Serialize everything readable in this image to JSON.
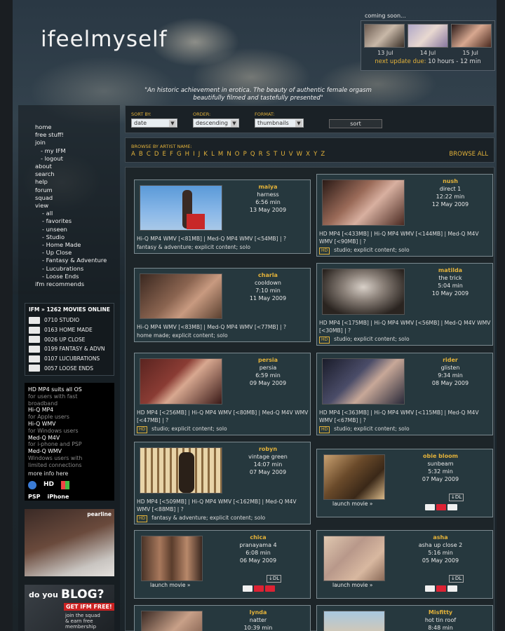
{
  "site": {
    "logo": "ifeelmyself",
    "tagline_line1": "\"An historic achievement in erotica. The beauty of authentic female orgasm",
    "tagline_line2": "beautifully filmed and tastefully presented\""
  },
  "coming_soon": {
    "title": "coming soon...",
    "dates": [
      "13 Jul",
      "14 Jul",
      "15 Jul"
    ],
    "next_update_label": "next update due:",
    "next_update_value": "10 hours - 12 min"
  },
  "menu": {
    "items": [
      "home",
      "free stuff!",
      "join"
    ],
    "join_sub": [
      "- my IFM",
      "- logout"
    ],
    "items2": [
      "about",
      "search",
      "help",
      "forum",
      "squad",
      "view"
    ],
    "view_sub": [
      "- all",
      "- favorites",
      "- unseen",
      "- Studio",
      "- Home Made",
      "- Up Close",
      "- Fantasy & Adventure",
      "- Lucubrations",
      "- Loose Ends"
    ],
    "last": "ifm recommends"
  },
  "ifm_online": {
    "title": "IFM » 1262 MOVIES ONLINE",
    "rows": [
      "0710 STUDIO",
      "0163 HOME MADE",
      "0026 UP CLOSE",
      "0199 FANTASY & ADVN",
      "0107 LUCUBRATIONS",
      "0057 LOOSE ENDS"
    ]
  },
  "formats": {
    "hd_title": "HD MP4 suits all OS",
    "hd_desc1": "for users with fast",
    "hd_desc2": "broadband",
    "hiq_mp4_title": "Hi-Q MP4",
    "hiq_mp4_desc": "for Apple users",
    "hiq_wmv_title": "Hi-Q WMV",
    "hiq_wmv_desc": "for Windows users",
    "medq_m4v_title": "Med-Q M4V",
    "medq_m4v_desc": "for i-phone and PSP",
    "medq_wmv_title": "Med-Q WMV",
    "medq_wmv_desc1": "Windows users with",
    "medq_wmv_desc2": "limited connections",
    "more": "more info here",
    "brand_hd": "HD",
    "brand_psp": "PSP",
    "brand_iphone": "iPhone"
  },
  "promo": {
    "pearline": "pearline",
    "blog_doyou": "do you",
    "blog_big": "BLOG?",
    "blog_ifm": "GET IFM FREE!",
    "blog_join1": "join the squad",
    "blog_join2": "& earn free",
    "blog_join3": "membership"
  },
  "filters": {
    "sort_by_label": "SORT BY:",
    "sort_by_value": "date",
    "order_label": "ORDER:",
    "order_value": "descending",
    "format_label": "FORMAT:",
    "format_value": "thumbnails",
    "sort_button": "sort",
    "browse_label": "BROWSE BY ARTIST NAME:",
    "letters": "A B C D E F G H I J K L M N O P Q R S T U V W X Y Z",
    "browse_all": "BROWSE ALL"
  },
  "cards": [
    {
      "name": "maiya",
      "title": "harness",
      "duration": "6:56 min",
      "date": "13 May 2009",
      "links": "Hi-Q MP4 WMV [<81MB] | Med-Q MP4 WMV [<54MB] | ?",
      "tags": "fantasy & adventure; explicit content; solo"
    },
    {
      "name": "nush",
      "title": "direct 1",
      "duration": "12:22 min",
      "date": "12 May 2009",
      "links": "HD MP4 [<433MB] | Hi-Q MP4 WMV [<144MB] | Med-Q M4V WMV [<90MB] | ?",
      "tags": "studio; explicit content; solo"
    },
    {
      "name": "charla",
      "title": "cooldown",
      "duration": "7:10 min",
      "date": "11 May 2009",
      "links": "Hi-Q MP4 WMV [<83MB] | Med-Q MP4 WMV [<77MB] | ?",
      "tags": "home made; explicit content; solo"
    },
    {
      "name": "matilda",
      "title": "the trick",
      "duration": "5:04 min",
      "date": "10 May 2009",
      "links": "HD MP4 [<175MB] | Hi-Q MP4 WMV [<56MB] | Med-Q M4V WMV [<30MB] | ?",
      "tags": "studio; explicit content; solo"
    },
    {
      "name": "persia",
      "title": "persia",
      "duration": "6:59 min",
      "date": "09 May 2009",
      "links": "HD MP4 [<256MB] | Hi-Q MP4 WMV [<80MB] | Med-Q M4V WMV [<47MB] | ?",
      "tags": "studio; explicit content; solo"
    },
    {
      "name": "rider",
      "title": "glisten",
      "duration": "9:34 min",
      "date": "08 May 2009",
      "links": "HD MP4 [<363MB] | Hi-Q MP4 WMV [<115MB] | Med-Q M4V WMV [<67MB] | ?",
      "tags": "studio; explicit content; solo"
    },
    {
      "name": "robyn",
      "title": "vintage green",
      "duration": "14:07 min",
      "date": "07 May 2009",
      "links": "HD MP4 [<509MB] | Hi-Q MP4 WMV [<162MB] | Med-Q M4V WMV [<88MB] | ?",
      "tags": "fantasy & adventure; explicit content; solo"
    },
    {
      "name": "obie bloom",
      "title": "sunbeam",
      "duration": "5:32 min",
      "date": "07 May 2009",
      "launch": "launch movie »",
      "dl": "↓DL"
    },
    {
      "name": "chica",
      "title": "pranayama 4",
      "duration": "6:08 min",
      "date": "06 May 2009",
      "launch": "launch movie »",
      "dl": "↓DL"
    },
    {
      "name": "asha",
      "title": "asha up close 2",
      "duration": "5:16 min",
      "date": "05 May 2009",
      "launch": "launch movie »",
      "dl": "↓DL"
    },
    {
      "name": "lynda",
      "title": "natter",
      "duration": "10:39 min"
    },
    {
      "name": "Misfitty",
      "title": "hot tin roof",
      "duration": "8:48 min"
    }
  ],
  "colors": {
    "accent": "#e3b23a",
    "card_bg": "#26383e",
    "panel_bg": "#1a2126"
  }
}
